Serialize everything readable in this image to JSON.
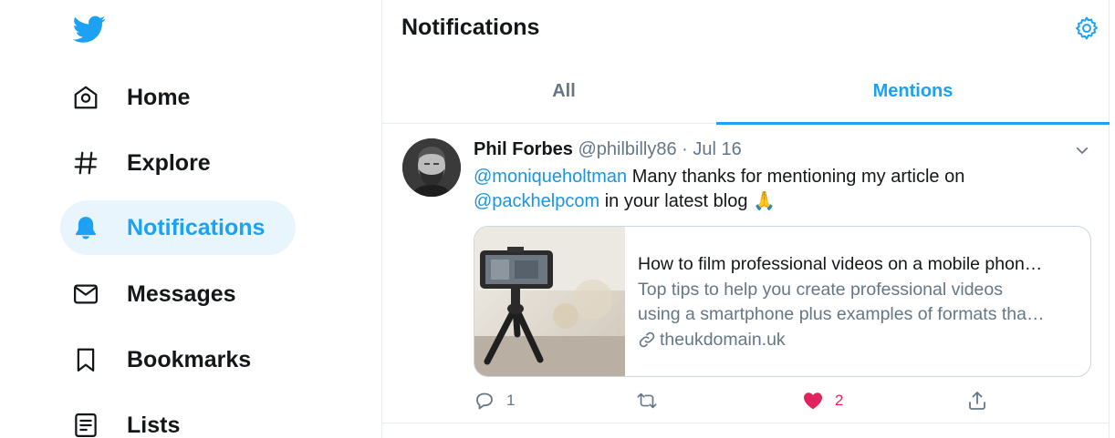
{
  "sidebar": {
    "logo_icon": "twitter-bird-icon",
    "items": [
      {
        "label": "Home",
        "icon": "home-icon"
      },
      {
        "label": "Explore",
        "icon": "hashtag-icon"
      },
      {
        "label": "Notifications",
        "icon": "bell-icon",
        "active": true
      },
      {
        "label": "Messages",
        "icon": "envelope-icon"
      },
      {
        "label": "Bookmarks",
        "icon": "bookmark-icon"
      },
      {
        "label": "Lists",
        "icon": "list-icon"
      }
    ]
  },
  "header": {
    "title": "Notifications",
    "settings_icon": "gear-icon"
  },
  "tabs": [
    {
      "label": "All",
      "active": false
    },
    {
      "label": "Mentions",
      "active": true
    }
  ],
  "tweet": {
    "name": "Phil Forbes",
    "handle": "@philbilly86",
    "separator": "·",
    "date": "Jul 16",
    "text": {
      "mention1": "@moniqueholtman",
      "part1": " Many thanks for mentioning my article on",
      "mention2": "@packhelpcom",
      "part2": " in your latest blog 🙏"
    },
    "card": {
      "title": "How to film professional videos on a mobile phon…",
      "description_line1": "Top tips to help you create professional videos",
      "description_line2": "using a smartphone plus examples of formats tha…",
      "domain": "theukdomain.uk"
    },
    "actions": {
      "reply_count": "1",
      "retweet_count": "",
      "like_count": "2",
      "liked": true
    }
  },
  "colors": {
    "accent": "#1da1f2",
    "active_bg": "#e8f5fd",
    "muted": "#657786",
    "like": "#e0245e",
    "border": "#e6ecf0"
  }
}
